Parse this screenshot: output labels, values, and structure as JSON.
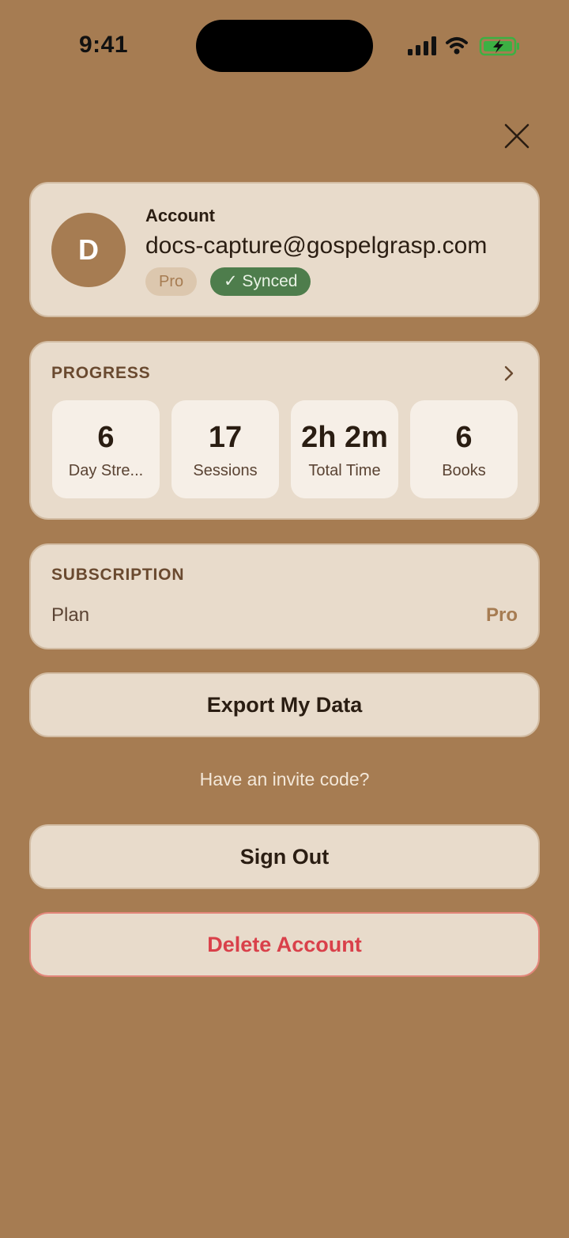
{
  "status_bar": {
    "time": "9:41"
  },
  "account": {
    "avatar_initial": "D",
    "label": "Account",
    "email": "docs-capture@gospelgrasp.com",
    "plan_badge": "Pro",
    "sync_badge": "✓ Synced"
  },
  "progress": {
    "title": "PROGRESS",
    "stats": [
      {
        "value": "6",
        "label": "Day Stre..."
      },
      {
        "value": "17",
        "label": "Sessions"
      },
      {
        "value": "2h 2m",
        "label": "Total Time"
      },
      {
        "value": "6",
        "label": "Books"
      }
    ]
  },
  "subscription": {
    "title": "SUBSCRIPTION",
    "plan_label": "Plan",
    "plan_value": "Pro"
  },
  "actions": {
    "export": "Export My Data",
    "invite": "Have an invite code?",
    "sign_out": "Sign Out",
    "delete": "Delete Account"
  },
  "colors": {
    "background": "#A67C52",
    "card": "#E8DBCB",
    "synced_green": "#4E7D4C",
    "danger": "#D9404A"
  }
}
